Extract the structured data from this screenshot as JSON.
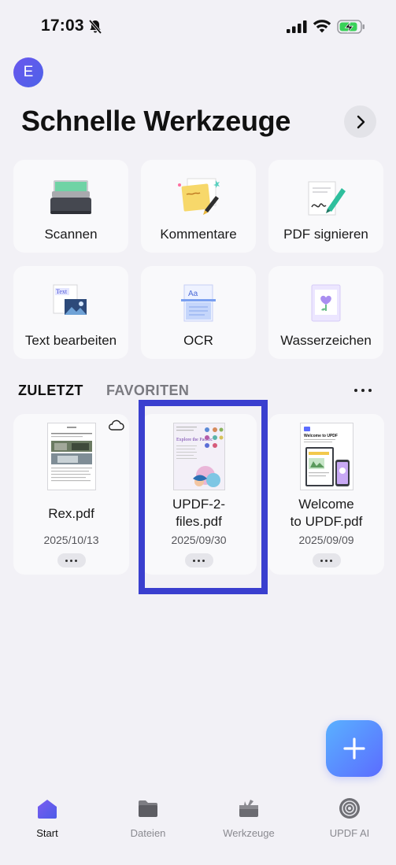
{
  "status": {
    "time": "17:03"
  },
  "user": {
    "initial": "E"
  },
  "header": {
    "title": "Schnelle Werkzeuge"
  },
  "tools": [
    {
      "label": "Scannen",
      "icon": "scanner-icon"
    },
    {
      "label": "Kommentare",
      "icon": "sticky-note-icon"
    },
    {
      "label": "PDF signieren",
      "icon": "signature-pen-icon"
    },
    {
      "label": "Text bearbeiten",
      "icon": "edit-text-icon"
    },
    {
      "label": "OCR",
      "icon": "ocr-icon"
    },
    {
      "label": "Wasserzeichen",
      "icon": "watermark-icon"
    }
  ],
  "tabs": {
    "recent": "ZULETZT",
    "favorites": "FAVORITEN"
  },
  "files": [
    {
      "name": "Rex.pdf",
      "date": "2025/10/13",
      "cloud": true
    },
    {
      "name": "UPDF-2-files.pdf",
      "name_line1": "UPDF-2-",
      "name_line2": "files.pdf",
      "date": "2025/09/30"
    },
    {
      "name": "Welcome to UPDF.pdf",
      "name_line1": "Welcome",
      "name_line2": "to UPDF.pdf",
      "date": "2025/09/09"
    }
  ],
  "thumb_text": {
    "updf2_heading": "Explore the Pacific",
    "welcome_heading": "Welcome to UPDF"
  },
  "nav": [
    {
      "label": "Start",
      "icon": "home-icon",
      "active": true
    },
    {
      "label": "Dateien",
      "icon": "folder-icon"
    },
    {
      "label": "Werkzeuge",
      "icon": "toolbox-icon"
    },
    {
      "label": "UPDF AI",
      "icon": "ai-icon"
    }
  ],
  "colors": {
    "accent": "#5b4fe8",
    "highlight": "#3a3fcf",
    "fab_start": "#5ab1ff",
    "fab_end": "#5b6cff"
  }
}
